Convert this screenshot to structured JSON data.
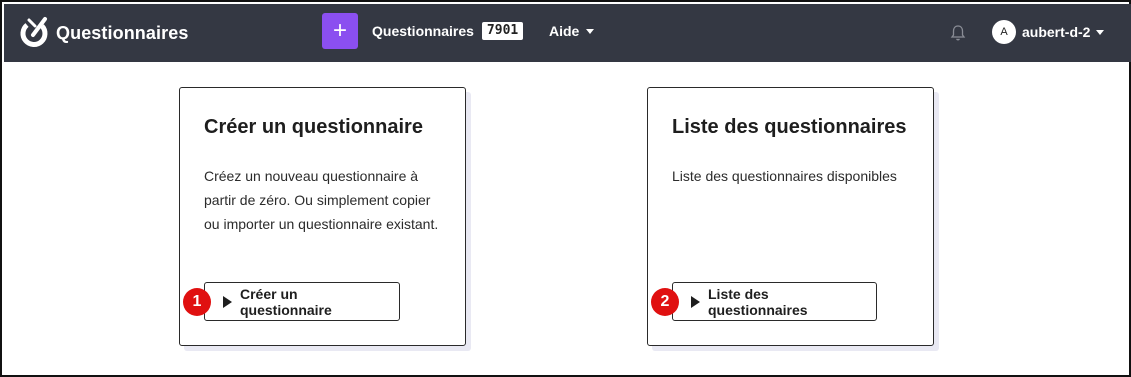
{
  "navbar": {
    "brand": "Questionnaires",
    "add_label": "+",
    "questionnaires_label": "Questionnaires",
    "questionnaires_count": "7901",
    "help_label": "Aide",
    "user_initial": "A",
    "user_name": "aubert-d-2"
  },
  "cards": [
    {
      "title": "Créer un questionnaire",
      "text": "Créez un nouveau questionnaire à partir de zéro. Ou simplement copier ou importer un questionnaire existant.",
      "button_label": "Créer un questionnaire",
      "step": "1"
    },
    {
      "title": "Liste des questionnaires",
      "text": "Liste des questionnaires disponibles",
      "button_label": "Liste des questionnaires",
      "step": "2"
    }
  ],
  "colors": {
    "navbar_bg": "#343843",
    "accent": "#8b4ff0",
    "step_badge": "#e01010"
  },
  "icons": {
    "logo": "questionnaire-logo-icon",
    "notification": "bell-icon",
    "button": "play-icon"
  }
}
